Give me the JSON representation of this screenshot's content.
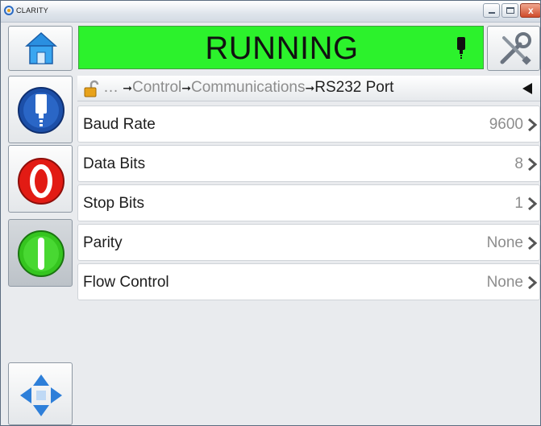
{
  "window": {
    "app_name": "CLARITY",
    "close_glyph": "x"
  },
  "header": {
    "status_text": "RUNNING",
    "status_color": "#2cf22c",
    "home_icon": "home-icon",
    "tools_icon": "tools-icon",
    "status_icon": "printhead-icon"
  },
  "sidebar": {
    "buttons": [
      {
        "name": "printhead-button",
        "icon": "printhead-icon",
        "color": "#1c4fa8"
      },
      {
        "name": "stop-button",
        "icon": "stop-icon",
        "color": "#e21b14"
      },
      {
        "name": "start-button",
        "icon": "start-icon",
        "color": "#35c51f"
      },
      {
        "name": "navigate-button",
        "icon": "navigate-arrows-icon",
        "color": "#2e7fd9"
      }
    ]
  },
  "breadcrumb": {
    "ellipsis": "…",
    "items": [
      "Control",
      "Communications",
      "RS232 Port"
    ],
    "separator": "➞"
  },
  "settings": [
    {
      "label": "Baud Rate",
      "value": "9600"
    },
    {
      "label": "Data Bits",
      "value": "8"
    },
    {
      "label": "Stop Bits",
      "value": "1"
    },
    {
      "label": "Parity",
      "value": "None"
    },
    {
      "label": "Flow Control",
      "value": "None"
    }
  ]
}
